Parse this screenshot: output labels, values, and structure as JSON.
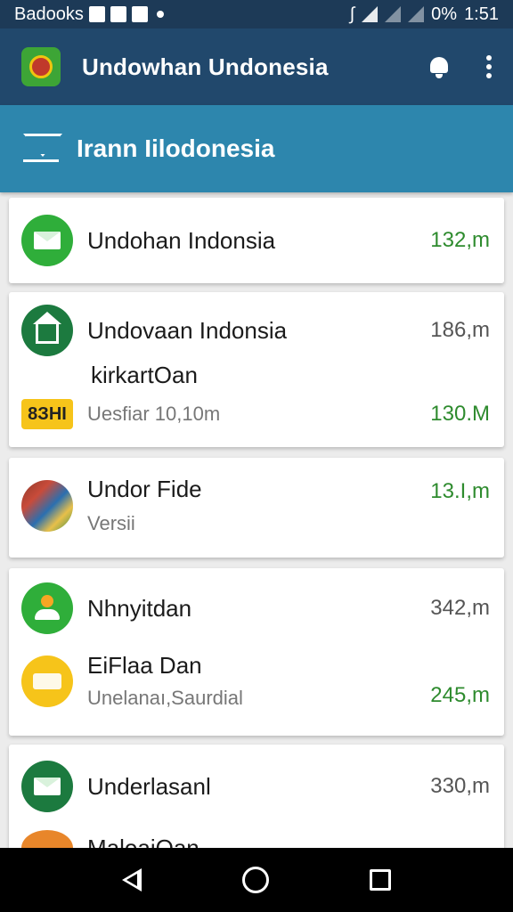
{
  "status_bar": {
    "carrier": "Badooks",
    "battery": "0%",
    "time": "1:51"
  },
  "app_bar": {
    "title": "Undowhan Undonesia"
  },
  "section": {
    "title": "Irann Iilodonesia"
  },
  "cards": [
    {
      "rows": [
        {
          "title": "Undohan Indonsia",
          "value": "132,m",
          "value_color": "#2e8b2e",
          "avatar": "mail-icon"
        }
      ]
    },
    {
      "rows": [
        {
          "title": "Undovaan Indonsia",
          "value": "186,m",
          "value_color": "#555555",
          "avatar": "house-icon"
        },
        {
          "title": "kirkartOan"
        },
        {
          "badge": "8ЗНI",
          "subtitle": "Uesfiar 10,10m",
          "value": "130.M",
          "value_color": "#2e8b2e"
        }
      ]
    },
    {
      "rows": [
        {
          "title": "Undor Fide",
          "subtitle": "Versii",
          "value": "13.I,m",
          "value_color": "#2e8b2e",
          "avatar": "photo-avatar"
        }
      ]
    },
    {
      "rows": [
        {
          "title": "Nhnyitdan",
          "value": "342,m",
          "value_color": "#555555",
          "avatar": "person-icon"
        },
        {
          "title": "EiFlaa Dan",
          "subtitle": "Unelanaı,Saurdial",
          "value": "245,m",
          "value_color": "#2e8b2e",
          "avatar": "keyboard-icon"
        }
      ]
    },
    {
      "rows": [
        {
          "title": "Underlasanl",
          "value": "330,m",
          "value_color": "#555555",
          "avatar": "mail-icon"
        },
        {
          "title": "MaloaiOan",
          "avatar": "orange-icon"
        }
      ]
    }
  ]
}
